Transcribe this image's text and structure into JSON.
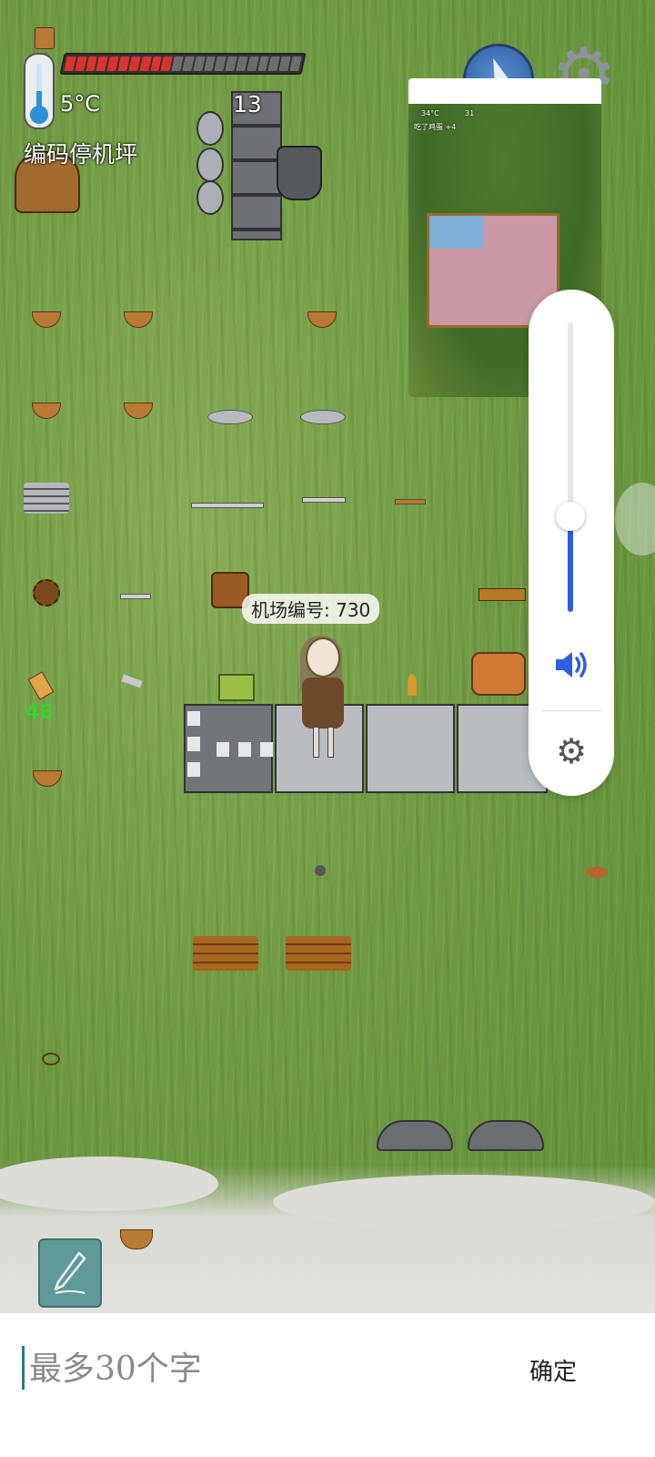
{
  "hud": {
    "temperature": "5°C",
    "location": "编码停机坪",
    "age": "13",
    "hunger_filled": 10,
    "hunger_total": 22
  },
  "tooltip": {
    "label": "机场编号: 730"
  },
  "floating_counter": "46",
  "mini_window": {
    "temperature": "34°C",
    "age": "31",
    "status": "吃了鸡蛋 +4"
  },
  "volume_panel": {
    "level": 0.33,
    "accent": "#2e5fe0"
  },
  "input_bar": {
    "placeholder": "最多30个字",
    "confirm_label": "确定"
  },
  "icons": [
    "thermometer-icon",
    "compass-icon",
    "settings-gear-icon",
    "speaker-icon",
    "gear-icon",
    "pencil-icon"
  ]
}
